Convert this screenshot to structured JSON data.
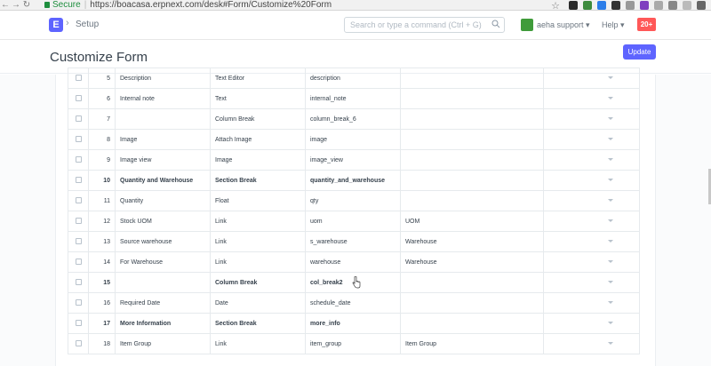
{
  "browser": {
    "secure_label": "Secure",
    "url": "https://boacasa.erpnext.com/desk#Form/Customize%20Form"
  },
  "navbar": {
    "logo_letter": "E",
    "breadcrumb": "Setup",
    "search_placeholder": "Search or type a command (Ctrl + G)",
    "user_name": "aeha support ▾",
    "help_label": "Help ▾",
    "notification_count": "20+"
  },
  "page": {
    "title": "Customize Form",
    "update_label": "Update"
  },
  "fields_table": {
    "rows": [
      {
        "idx": "5",
        "label": "Description",
        "type": "Text Editor",
        "fieldname": "description",
        "options": "",
        "bold": false
      },
      {
        "idx": "6",
        "label": "Internal note",
        "type": "Text",
        "fieldname": "internal_note",
        "options": "",
        "bold": false
      },
      {
        "idx": "7",
        "label": "",
        "type": "Column Break",
        "fieldname": "column_break_6",
        "options": "",
        "bold": false
      },
      {
        "idx": "8",
        "label": "Image",
        "type": "Attach Image",
        "fieldname": "image",
        "options": "",
        "bold": false
      },
      {
        "idx": "9",
        "label": "Image view",
        "type": "Image",
        "fieldname": "image_view",
        "options": "",
        "bold": false
      },
      {
        "idx": "10",
        "label": "Quantity and Warehouse",
        "type": "Section Break",
        "fieldname": "quantity_and_warehouse",
        "options": "",
        "bold": true
      },
      {
        "idx": "11",
        "label": "Quantity",
        "type": "Float",
        "fieldname": "qty",
        "options": "",
        "bold": false
      },
      {
        "idx": "12",
        "label": "Stock UOM",
        "type": "Link",
        "fieldname": "uom",
        "options": "UOM",
        "bold": false
      },
      {
        "idx": "13",
        "label": "Source warehouse",
        "type": "Link",
        "fieldname": "s_warehouse",
        "options": "Warehouse",
        "bold": false
      },
      {
        "idx": "14",
        "label": "For Warehouse",
        "type": "Link",
        "fieldname": "warehouse",
        "options": "Warehouse",
        "bold": false
      },
      {
        "idx": "15",
        "label": "",
        "type": "Column Break",
        "fieldname": "col_break2",
        "options": "",
        "bold": true
      },
      {
        "idx": "16",
        "label": "Required Date",
        "type": "Date",
        "fieldname": "schedule_date",
        "options": "",
        "bold": false
      },
      {
        "idx": "17",
        "label": "More Information",
        "type": "Section Break",
        "fieldname": "more_info",
        "options": "",
        "bold": true
      },
      {
        "idx": "18",
        "label": "Item Group",
        "type": "Link",
        "fieldname": "item_group",
        "options": "Item Group",
        "bold": false
      }
    ]
  },
  "colors": {
    "primary": "#5e64ff",
    "notification": "#ff5858",
    "secure": "#1e8e3e"
  }
}
